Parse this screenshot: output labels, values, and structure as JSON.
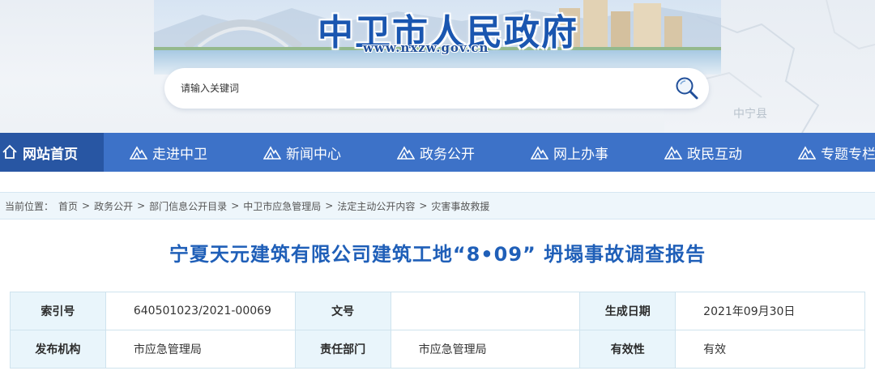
{
  "header": {
    "site_title": "中卫市人民政府",
    "site_url": "www.nxzw.gov.cn",
    "map_label": "中宁县",
    "search": {
      "placeholder": "请输入关键词"
    }
  },
  "nav": {
    "items": [
      {
        "label": "网站首页",
        "icon": "home-icon"
      },
      {
        "label": "走进中卫",
        "icon": "mountain-icon"
      },
      {
        "label": "新闻中心",
        "icon": "mountain-icon"
      },
      {
        "label": "政务公开",
        "icon": "mountain-icon"
      },
      {
        "label": "网上办事",
        "icon": "mountain-icon"
      },
      {
        "label": "政民互动",
        "icon": "mountain-icon"
      },
      {
        "label": "专题专栏",
        "icon": "mountain-icon"
      }
    ]
  },
  "breadcrumb": {
    "prefix": "当前位置：",
    "items": [
      "首页",
      "政务公开",
      "部门信息公开目录",
      "中卫市应急管理局",
      "法定主动公开内容",
      "灾害事故救援"
    ]
  },
  "article": {
    "title": "宁夏天元建筑有限公司建筑工地“8•09” 坍塌事故调查报告"
  },
  "meta": {
    "index_no_label": "索引号",
    "index_no_value": "640501023/2021-00069",
    "doc_no_label": "文号",
    "doc_no_value": "",
    "date_label": "生成日期",
    "date_value": "2021年09月30日",
    "publisher_label": "发布机构",
    "publisher_value": "市应急管理局",
    "dept_label": "责任部门",
    "dept_value": "市应急管理局",
    "validity_label": "有效性",
    "validity_value": "有效"
  },
  "colors": {
    "nav_bg": "#3d72c8",
    "nav_home_bg": "#2856a3",
    "title_blue": "#1f5fb8",
    "crumb_bg": "#eef6fb",
    "table_key_bg": "#e9f5fb"
  }
}
